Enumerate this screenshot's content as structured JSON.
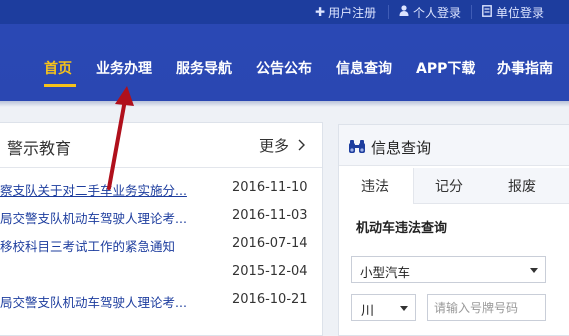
{
  "topbar": {
    "register": "用户注册",
    "personal_login": "个人登录",
    "unit_login": "单位登录"
  },
  "nav": {
    "items": [
      "首页",
      "业务办理",
      "服务导航",
      "公告公布",
      "信息查询",
      "APP下载",
      "办事指南"
    ],
    "active_index": 0
  },
  "warning_section": {
    "title": "警示教育",
    "more": "更多",
    "news": [
      {
        "title": "察支队关于对二手车业务实施分...",
        "date": "2016-11-10"
      },
      {
        "title": "局交警支队机动车驾驶人理论考...",
        "date": "2016-11-03"
      },
      {
        "title": "移校科目三考试工作的紧急通知",
        "date": "2016-07-14"
      },
      {
        "title": "",
        "date": "2015-12-04"
      },
      {
        "title": "局交警支队机动车驾驶人理论考...",
        "date": "2016-10-21"
      }
    ]
  },
  "info_query": {
    "title": "信息查询",
    "tabs": [
      "违法",
      "记分",
      "报废"
    ],
    "active_tab": 0,
    "form_title": "机动车违法查询",
    "vehicle_type": "小型汽车",
    "province": "川",
    "plate_placeholder": "请输入号牌号码"
  },
  "colors": {
    "header_blue": "#2a48b4",
    "topbar_blue": "#1d3d9e",
    "active_yellow": "#f5c21b",
    "annotation_red": "#b0101c"
  }
}
